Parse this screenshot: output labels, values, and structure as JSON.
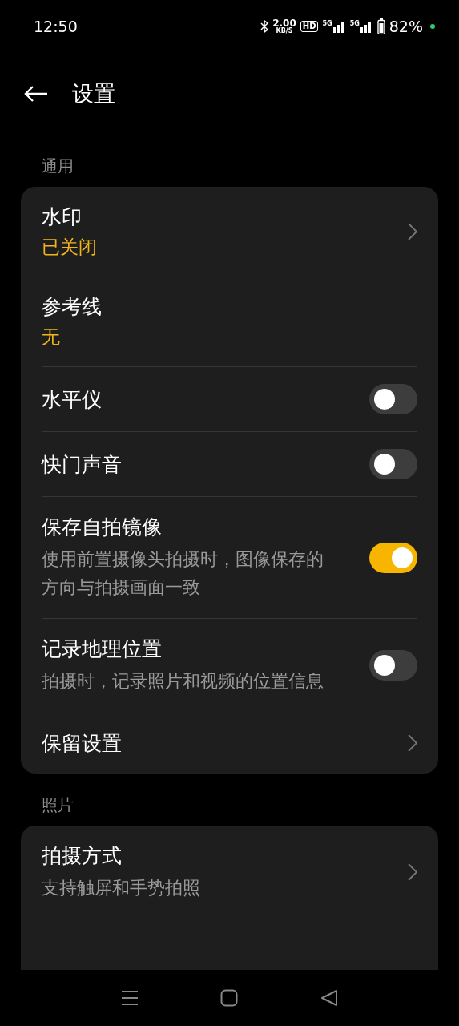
{
  "status_bar": {
    "time": "12:50",
    "speed": "2.00",
    "speed_unit": "KB/S",
    "hd": "HD",
    "network_1": "5G",
    "network_2": "5G",
    "battery": "82%"
  },
  "header": {
    "title": "设置"
  },
  "sections": [
    {
      "label": "通用",
      "items": [
        {
          "kind": "nav",
          "title": "水印",
          "value": "已关闭",
          "divider_before": false
        },
        {
          "kind": "value",
          "title": "参考线",
          "value": "无",
          "divider_before": false
        },
        {
          "kind": "toggle",
          "title": "水平仪",
          "on": false,
          "divider_before": true
        },
        {
          "kind": "toggle",
          "title": "快门声音",
          "on": false,
          "divider_before": true
        },
        {
          "kind": "toggle",
          "title": "保存自拍镜像",
          "description": "使用前置摄像头拍摄时，图像保存的方向与拍摄画面一致",
          "on": true,
          "divider_before": true
        },
        {
          "kind": "toggle",
          "title": "记录地理位置",
          "description": "拍摄时，记录照片和视频的位置信息",
          "on": false,
          "divider_before": true
        },
        {
          "kind": "nav",
          "title": "保留设置",
          "divider_before": true
        }
      ]
    },
    {
      "label": "照片",
      "items": [
        {
          "kind": "nav",
          "title": "拍摄方式",
          "description": "支持触屏和手势拍照",
          "divider_before": false
        }
      ]
    }
  ]
}
